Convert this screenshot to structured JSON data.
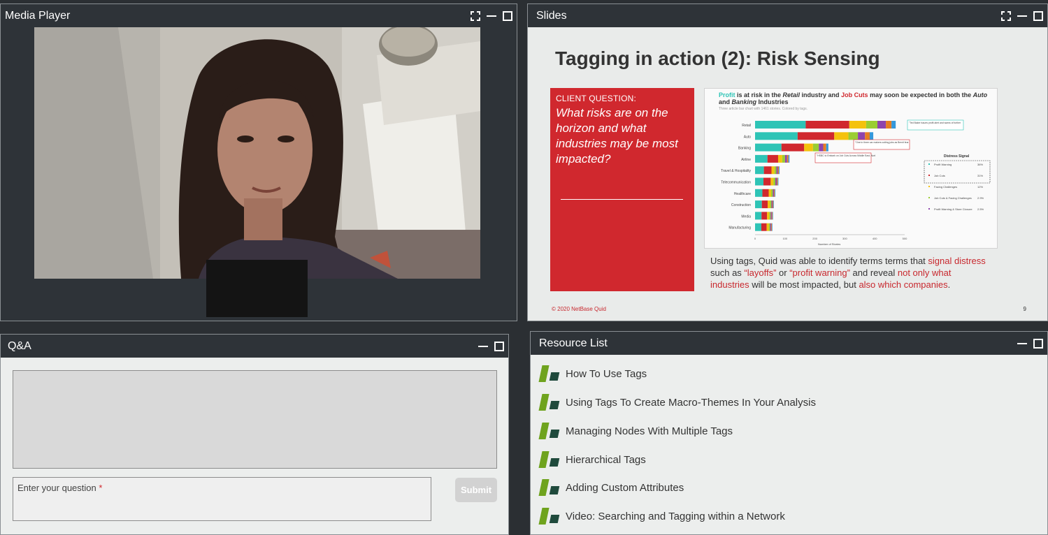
{
  "media_player": {
    "title": "Media Player"
  },
  "slides_panel": {
    "title": "Slides",
    "slide": {
      "title": "Tagging in action (2): Risk Sensing",
      "client_label": "CLIENT QUESTION:",
      "question": "What risks are on the horizon and what industries may be most impacted?",
      "chart_headline_a": "Profit",
      "chart_headline_b": " is at risk in the ",
      "chart_headline_c": "Retail",
      "chart_headline_d": " industry and ",
      "chart_headline_e": "Job Cuts",
      "chart_headline_f": " may soon be expected in both the ",
      "chart_headline_g": "Auto",
      "chart_headline_h": " and ",
      "chart_headline_i": "Banking",
      "chart_headline_j": " Industries",
      "chart_sub": "Three article bar chart with 1461 stories. Colored by tags.",
      "caption_1": "Using tags, Quid was able to identify terms terms that ",
      "caption_2": "signal distress",
      "caption_3": " such as ",
      "caption_4": "“layoffs”",
      "caption_5": " or ",
      "caption_6": "“profit warning”",
      "caption_7": " and reveal ",
      "caption_8": "not only what industries",
      "caption_9": " will be most impacted, but ",
      "caption_10": "also which companies",
      "caption_11": ".",
      "footer": "© 2020 NetBase Quid",
      "page_number": "9"
    }
  },
  "chart_data": {
    "type": "bar",
    "categories": [
      "Retail",
      "Auto",
      "Banking",
      "Airline",
      "Travel & Hospitality",
      "Telecommunication",
      "Healthcare",
      "Construction",
      "Media",
      "Manufacturing"
    ],
    "values": [
      470,
      395,
      245,
      115,
      82,
      78,
      68,
      63,
      60,
      58
    ],
    "xlabel": "Number of Stories",
    "xticks": [
      0,
      100,
      200,
      300,
      400,
      500
    ],
    "xlim": [
      0,
      500
    ],
    "legend_title": "Distress Signal",
    "legend": [
      {
        "name": "Profit Warning",
        "value": "36%",
        "color": "#2ec4b6"
      },
      {
        "name": "Job Cuts",
        "value": "31%",
        "color": "#d0282e"
      },
      {
        "name": "Facing Challenges",
        "value": "12%",
        "color": "#f4c20d"
      },
      {
        "name": "Job Cuts & Facing Challenges",
        "value": "2.9%",
        "color": "#9acd32"
      },
      {
        "name": "Profit Warning & Store Closure",
        "value": "2.5%",
        "color": "#8e44ad"
      }
    ],
    "annotations": [
      "\"Ted Baker issues profit alert and warns of further hit\"",
      "\"One in three car makers cutting jobs as Brexit fears intensify\"",
      "\"HSBC to Embark on Job Cuts Across Middle East, North Africa\""
    ],
    "legend_placement": "right"
  },
  "qa": {
    "title": "Q&A",
    "input_label": "Enter your question",
    "required_mark": "*",
    "submit_label": "Submit"
  },
  "resources": {
    "title": "Resource List",
    "items": [
      {
        "label": "How To Use Tags"
      },
      {
        "label": "Using Tags To Create Macro-Themes In Your Analysis"
      },
      {
        "label": "Managing Nodes With Multiple Tags"
      },
      {
        "label": "Hierarchical Tags"
      },
      {
        "label": "Adding Custom Attributes"
      },
      {
        "label": "Video: Searching and Tagging within a Network"
      }
    ]
  }
}
